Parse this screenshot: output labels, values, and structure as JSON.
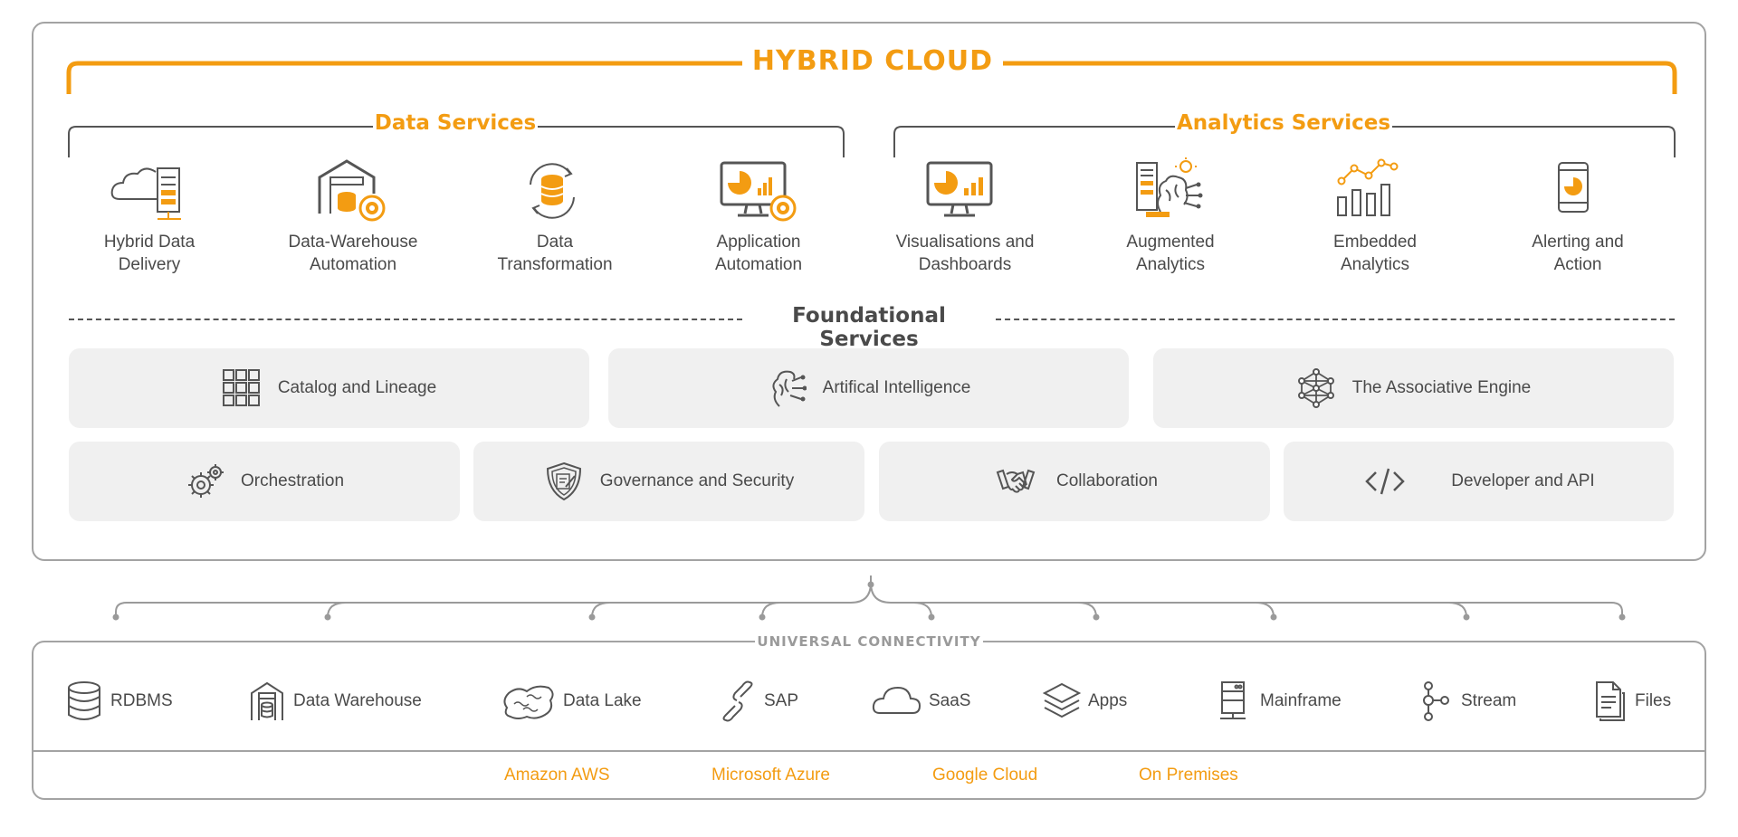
{
  "hybrid_cloud": {
    "title": "HYBRID CLOUD"
  },
  "data_services": {
    "title": "Data Services",
    "items": [
      {
        "label_line1": "Hybrid Data",
        "label_line2": "Delivery",
        "icon": "cloud-server-icon"
      },
      {
        "label_line1": "Data-Warehouse",
        "label_line2": "Automation",
        "icon": "warehouse-gear-icon"
      },
      {
        "label_line1": "Data",
        "label_line2": "Transformation",
        "icon": "database-cycle-icon"
      },
      {
        "label_line1": "Application",
        "label_line2": "Automation",
        "icon": "monitor-chart-gear-icon"
      }
    ]
  },
  "analytics_services": {
    "title": "Analytics Services",
    "items": [
      {
        "label_line1": "Visualisations and",
        "label_line2": "Dashboards",
        "icon": "monitor-chart-icon"
      },
      {
        "label_line1": "Augmented",
        "label_line2": "Analytics",
        "icon": "brain-server-icon"
      },
      {
        "label_line1": "Embedded",
        "label_line2": "Analytics",
        "icon": "bar-line-chart-icon"
      },
      {
        "label_line1": "Alerting and",
        "label_line2": "Action",
        "icon": "mobile-pie-icon"
      }
    ]
  },
  "foundational_services": {
    "title": "Foundational Services",
    "row1": [
      {
        "label": "Catalog and Lineage",
        "icon": "grid-icon"
      },
      {
        "label": "Artifical Intelligence",
        "icon": "brain-circuit-icon"
      },
      {
        "label": "The Associative Engine",
        "icon": "network-icon"
      }
    ],
    "row2": [
      {
        "label": "Orchestration",
        "icon": "gears-icon"
      },
      {
        "label": "Governance and Security",
        "icon": "shield-icon"
      },
      {
        "label": "Collaboration",
        "icon": "handshake-icon"
      },
      {
        "label": "Developer and API",
        "icon": "code-icon"
      }
    ]
  },
  "connectivity": {
    "title": "UNIVERSAL CONNECTIVITY",
    "sources": [
      {
        "label": "RDBMS",
        "icon": "database-icon"
      },
      {
        "label": "Data Warehouse",
        "icon": "warehouse-icon"
      },
      {
        "label": "Data Lake",
        "icon": "lake-icon"
      },
      {
        "label": "SAP",
        "icon": "link-icon"
      },
      {
        "label": "SaaS",
        "icon": "cloud-icon"
      },
      {
        "label": "Apps",
        "icon": "layers-icon"
      },
      {
        "label": "Mainframe",
        "icon": "server-icon"
      },
      {
        "label": "Stream",
        "icon": "stream-icon"
      },
      {
        "label": "Files",
        "icon": "files-icon"
      }
    ],
    "platforms": [
      "Amazon AWS",
      "Microsoft Azure",
      "Google Cloud",
      "On Premises"
    ]
  },
  "colors": {
    "accent": "#f39c12",
    "text": "#4a4a4a",
    "border": "#a3a3a3",
    "tile": "#f0f0f0"
  }
}
